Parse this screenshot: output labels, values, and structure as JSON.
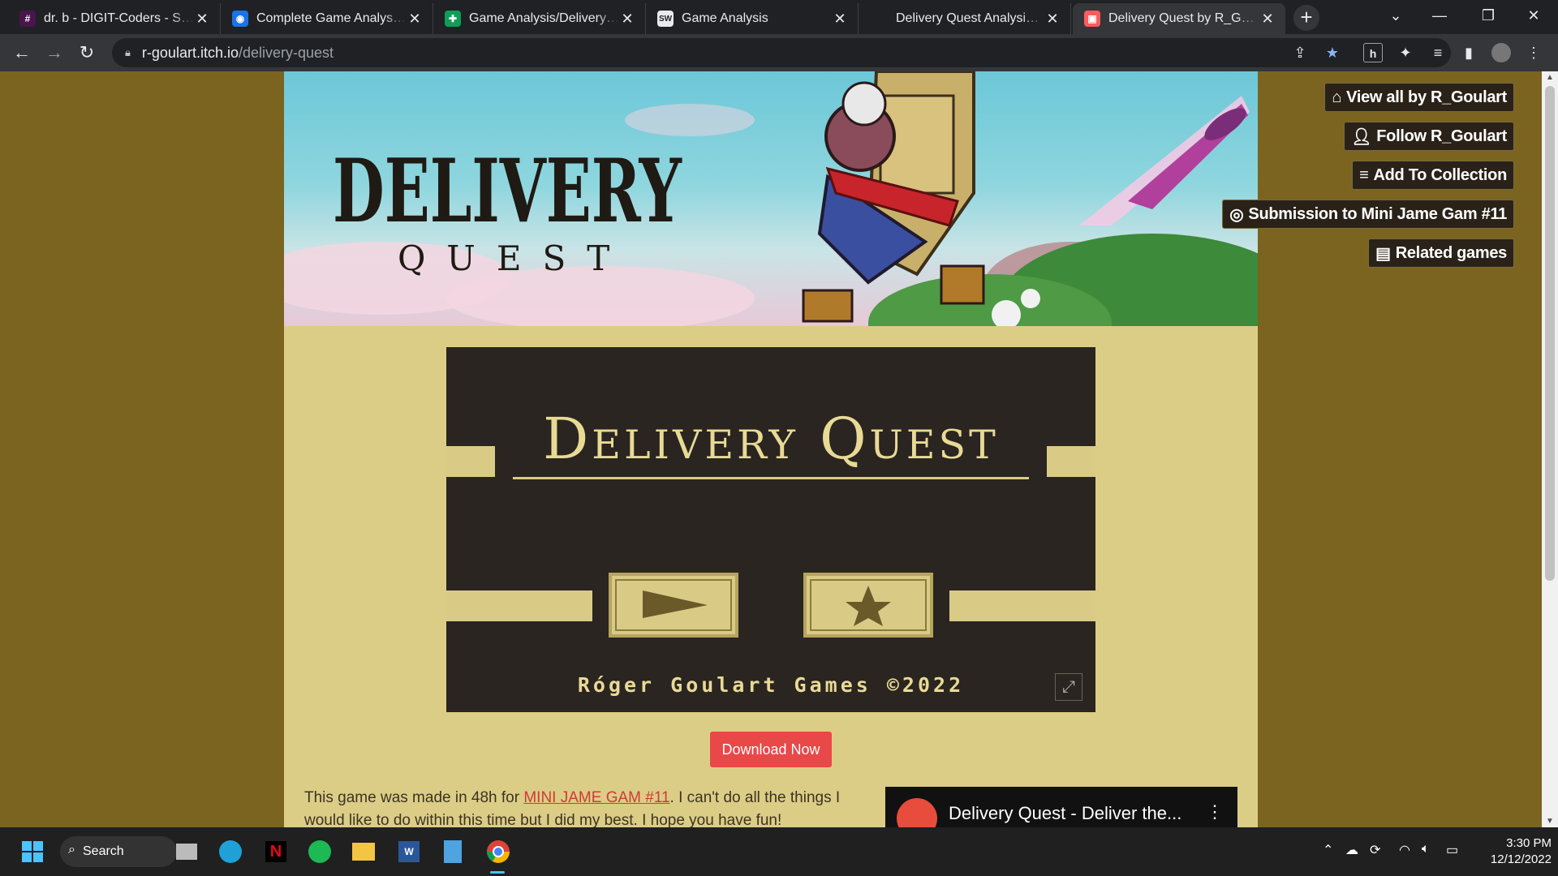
{
  "tabs": [
    {
      "title": "dr. b - DIGIT-Coders - Slack",
      "icon": "slack-icon"
    },
    {
      "title": "Complete Game Analysis Report",
      "icon": "document-icon"
    },
    {
      "title": "Game Analysis/Delivery Quest",
      "icon": "sheets-icon"
    },
    {
      "title": "Game Analysis",
      "icon": "studio-icon"
    },
    {
      "title": "Delivery Quest Analysis • Docs",
      "icon": "docs-icon"
    },
    {
      "title": "Delivery Quest by R_Goulart",
      "icon": "itch-icon",
      "active": true
    }
  ],
  "address": {
    "host": "r-goulart.itch.io",
    "path": "/delivery-quest"
  },
  "banner": {
    "logo_main": "DELIVERY",
    "logo_sub": "QUEST"
  },
  "game": {
    "title": "Delivery Quest",
    "credit": "Róger Goulart Games ©2022"
  },
  "actions": {
    "view_all": "View all by R_Goulart",
    "follow": "Follow R_Goulart",
    "add_collection": "Add To Collection",
    "submission": "Submission to Mini Jame Gam #11",
    "related": "Related games"
  },
  "download_label": "Download Now",
  "description": {
    "prefix": "This game was made in 48h for ",
    "link": "MINI JAME GAM #11",
    "suffix": ". I can't do all the things I would like to do within this time but I did my best. I hope you have fun!"
  },
  "video": {
    "title": "Delivery Quest - Deliver the..."
  },
  "taskbar": {
    "search_label": "Search",
    "time": "3:30 PM",
    "date": "12/12/2022"
  },
  "colors": {
    "page_bg": "#7a6420",
    "column_bg": "#dbcd86",
    "game_bg": "#2a2520",
    "accent": "#e94848",
    "link": "#cf3a3a"
  }
}
